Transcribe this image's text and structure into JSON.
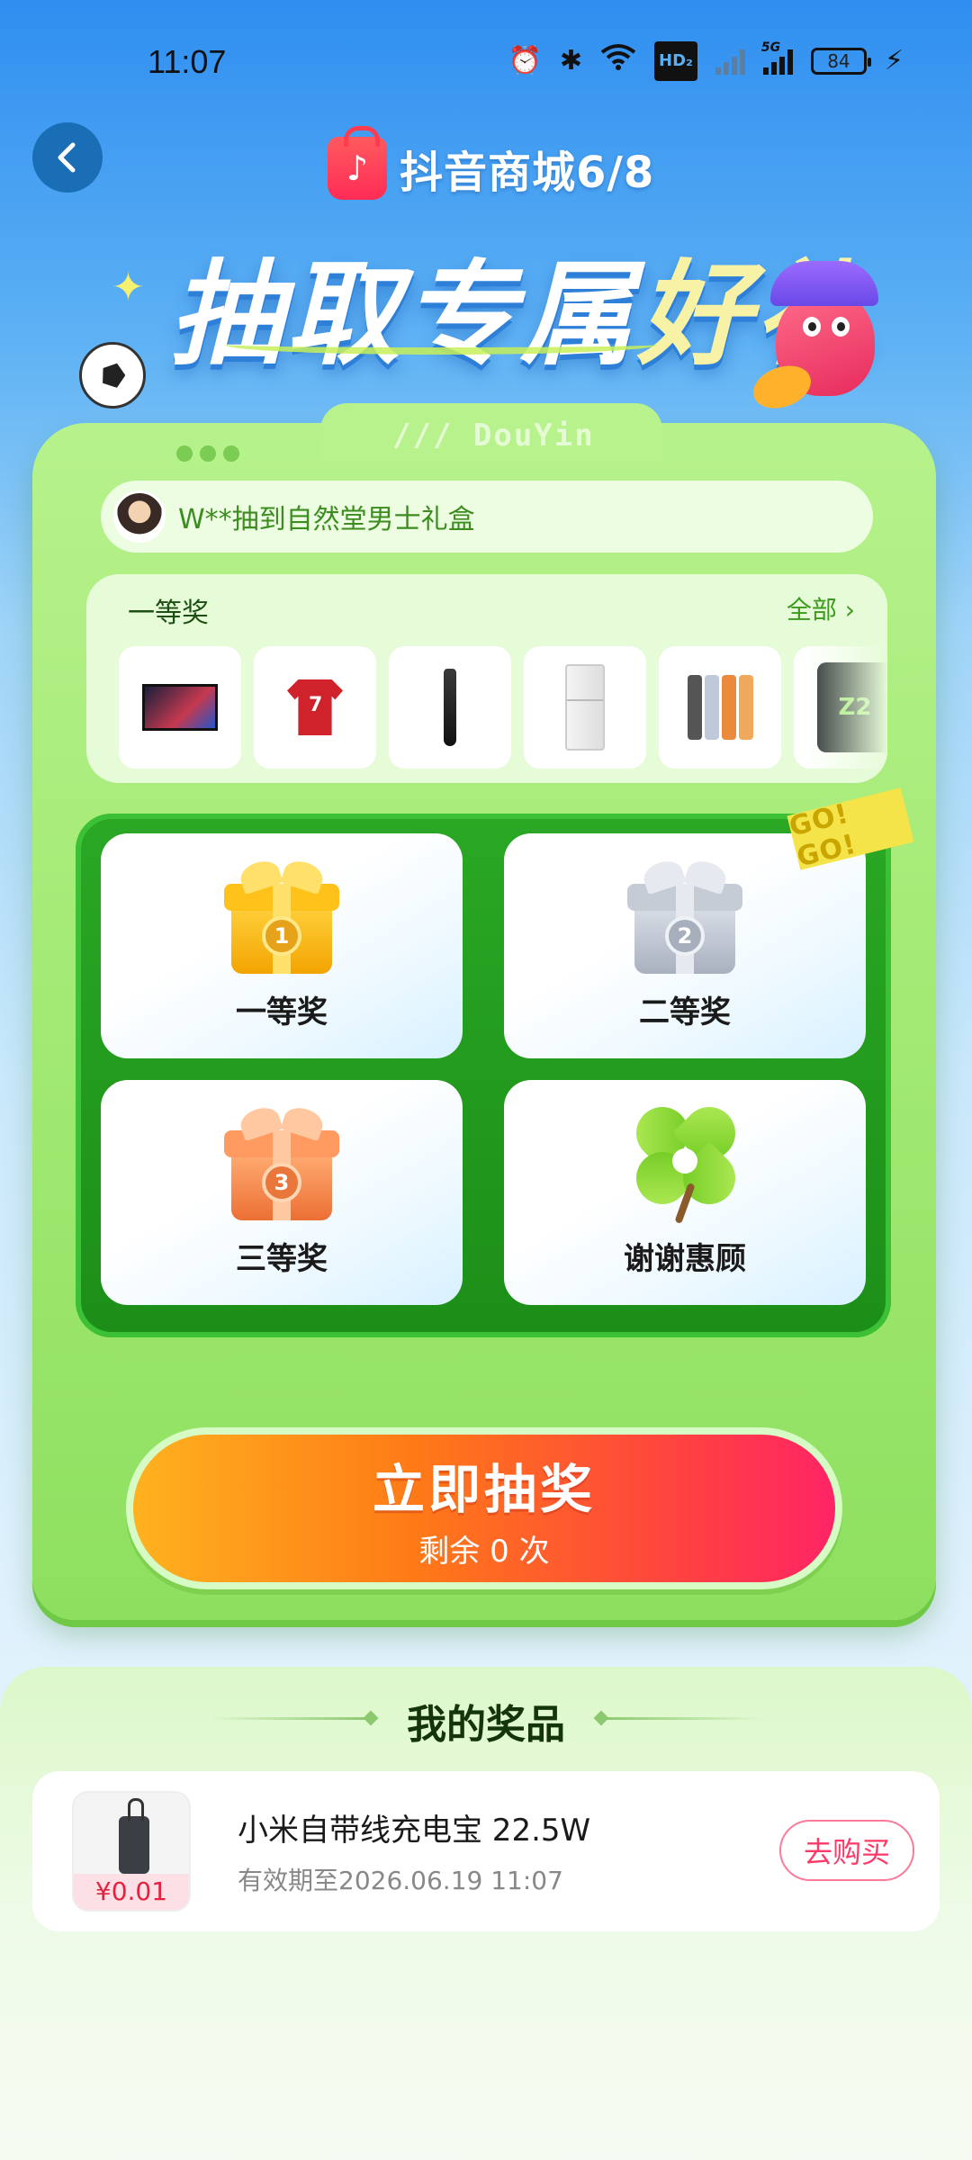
{
  "status_bar": {
    "time": "11:07",
    "icons": [
      "alarm-icon",
      "bluetooth-icon",
      "wifi-icon",
      "hd-icon",
      "signal-icon",
      "5g-signal-icon",
      "battery-icon",
      "charging-icon"
    ],
    "hd_label": "HD₂",
    "network_label": "5G",
    "battery_level": "84"
  },
  "header": {
    "brand_name": "抖音商城6/8",
    "hero_title_main": "抽取专属",
    "hero_title_accent": "好礼"
  },
  "machine": {
    "label": "/// DouYin",
    "ticker_text": "W**抽到自然堂男士礼盒",
    "prize_panel": {
      "title": "一等奖",
      "all_label": "全部",
      "items": [
        {
          "icon": "tv-icon"
        },
        {
          "icon": "jersey-icon"
        },
        {
          "icon": "bat-icon"
        },
        {
          "icon": "fridge-icon"
        },
        {
          "icon": "phones-icon"
        },
        {
          "icon": "device-icon",
          "text": "Z2"
        }
      ]
    },
    "grid": [
      {
        "label": "一等奖",
        "medal": "1"
      },
      {
        "label": "二等奖",
        "medal": "2"
      },
      {
        "label": "三等奖",
        "medal": "3"
      },
      {
        "label": "谢谢惠顾"
      }
    ],
    "go_tag": "GO! GO!",
    "draw_button": {
      "main": "立即抽奖",
      "sub": "剩余 0 次"
    }
  },
  "my_prizes": {
    "title": "我的奖品",
    "items": [
      {
        "name": "小米自带线充电宝 22.5W",
        "price": "¥0.01",
        "expiry": "有效期至2026.06.19 11:07",
        "action": "去购买"
      }
    ]
  },
  "colors": {
    "machine_green": "#9ee86f",
    "draw_button_start": "#ffb21f",
    "draw_button_end": "#ff2466",
    "price_red": "#e6213f"
  }
}
